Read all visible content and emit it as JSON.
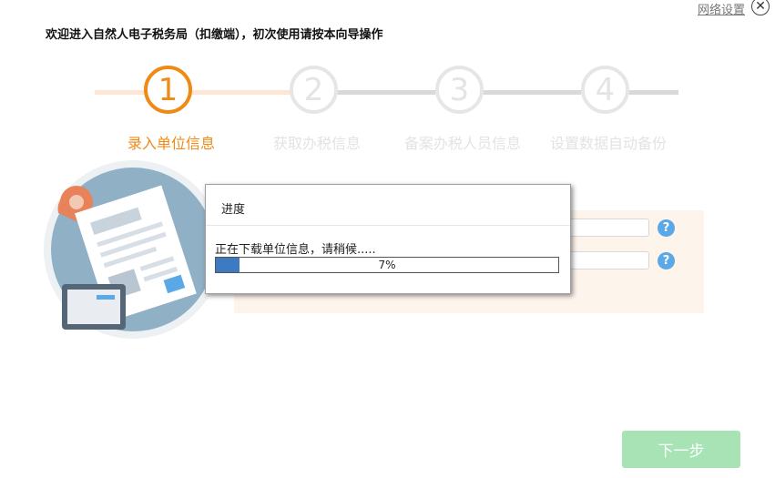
{
  "header": {
    "net_settings": "网络设置",
    "welcome": "欢迎进入自然人电子税务局（扣缴端），初次使用请按本向导操作"
  },
  "steps": [
    {
      "number": "1",
      "label": "录入单位信息",
      "state": "active"
    },
    {
      "number": "2",
      "label": "获取办税信息",
      "state": "inactive"
    },
    {
      "number": "3",
      "label": "备案办税人员信息",
      "state": "inactive"
    },
    {
      "number": "4",
      "label": "设置数据自动备份",
      "state": "inactive"
    }
  ],
  "colors": {
    "accent": "#f08a16",
    "inactive": "#e6e6e6",
    "progress_fill": "#3e7ac1",
    "next_button": "#a8e3b6",
    "help_icon": "#5aa8e6"
  },
  "form": {
    "help_icon_text": "?"
  },
  "dialog": {
    "title": "进度",
    "message": "正在下载单位信息，请稍候.....",
    "progress_text": "7%",
    "progress_value": 0.07
  },
  "footer": {
    "next_label": "下一步"
  }
}
